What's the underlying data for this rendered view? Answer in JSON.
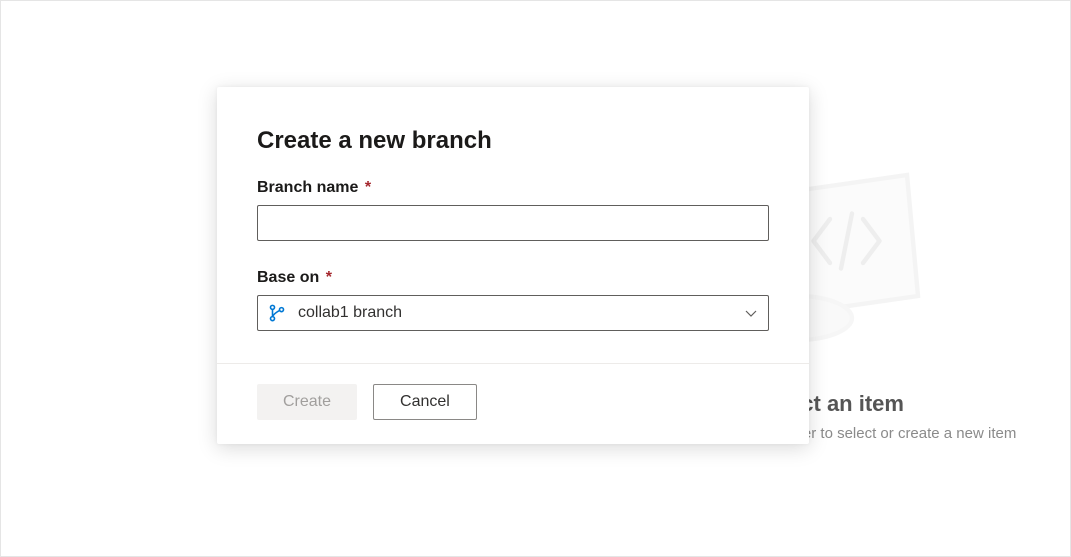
{
  "backdrop": {
    "title": "Select an item",
    "subtitle": "Use the resource explorer to select or create a new item"
  },
  "dialog": {
    "title": "Create a new branch",
    "branch_name_label": "Branch name",
    "branch_name_value": "",
    "base_on_label": "Base on",
    "base_on_value": "collab1 branch",
    "create_label": "Create",
    "cancel_label": "Cancel",
    "required_marker": "*"
  }
}
